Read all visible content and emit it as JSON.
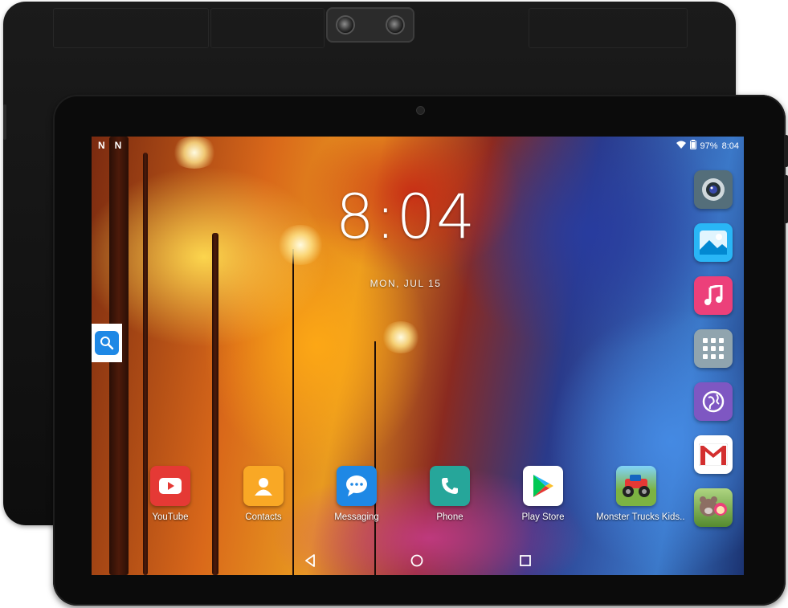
{
  "status_bar": {
    "notification_icons": [
      "N",
      "N"
    ],
    "battery_percent": "97%",
    "time": "8:04",
    "wifi_icon": "wifi-icon",
    "battery_icon": "battery-icon"
  },
  "lockscreen": {
    "clock": "8:04",
    "date": "MON, JUL 15"
  },
  "search_widget": {
    "icon": "search-icon"
  },
  "dock": [
    {
      "label": "YouTube",
      "icon": "youtube-icon",
      "color": "#e53935"
    },
    {
      "label": "Contacts",
      "icon": "contacts-icon",
      "color": "#f9a825"
    },
    {
      "label": "Messaging",
      "icon": "messaging-icon",
      "color": "#1e88e5"
    },
    {
      "label": "Phone",
      "icon": "phone-icon",
      "color": "#26a69a"
    },
    {
      "label": "Play Store",
      "icon": "play-store-icon",
      "color": "#ffffff"
    },
    {
      "label": "Monster Trucks Kids..",
      "icon": "monster-trucks-icon",
      "color": "#7cb342"
    }
  ],
  "side_apps": [
    {
      "name": "camera",
      "icon": "camera-icon",
      "color": "#607d8b"
    },
    {
      "name": "gallery",
      "icon": "gallery-icon",
      "color": "#29b6f6"
    },
    {
      "name": "music",
      "icon": "music-icon",
      "color": "#ec407a"
    },
    {
      "name": "all-apps",
      "icon": "apps-grid-icon",
      "color": "#90a4ae"
    },
    {
      "name": "browser",
      "icon": "browser-icon",
      "color": "#7e57c2"
    },
    {
      "name": "gmail",
      "icon": "gmail-icon",
      "color": "#ffffff"
    },
    {
      "name": "masha-game",
      "icon": "masha-bear-icon",
      "color": "#8bc34a"
    }
  ],
  "navbar": {
    "back": "back-icon",
    "home": "home-icon",
    "recents": "recents-icon"
  }
}
